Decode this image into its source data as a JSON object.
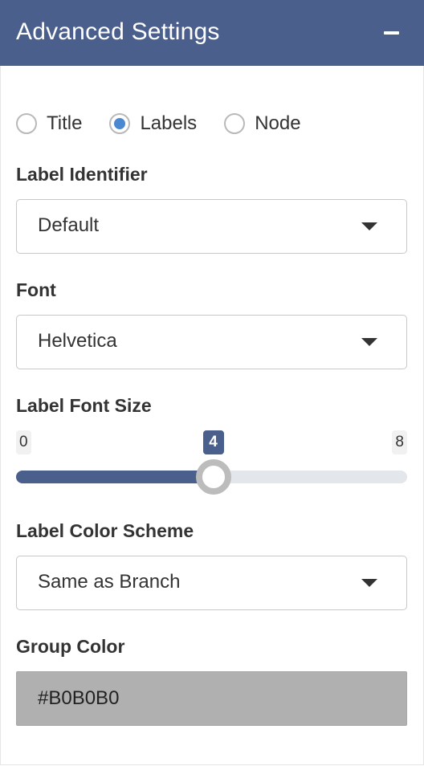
{
  "header": {
    "title": "Advanced Settings"
  },
  "label_mode": {
    "options": [
      {
        "label": "Title",
        "checked": false
      },
      {
        "label": "Labels",
        "checked": true
      },
      {
        "label": "Node",
        "checked": false
      }
    ]
  },
  "label_identifier": {
    "label": "Label Identifier",
    "value": "Default"
  },
  "font": {
    "label": "Font",
    "value": "Helvetica"
  },
  "label_font_size": {
    "label": "Label Font Size",
    "min": "0",
    "max": "8",
    "value": "4"
  },
  "label_color_scheme": {
    "label": "Label Color Scheme",
    "value": "Same as Branch"
  },
  "group_color": {
    "label": "Group Color",
    "value": "#B0B0B0"
  },
  "colors": {
    "header_bg": "#4a5f8c",
    "radio_accent": "#4a89d0",
    "group_color_swatch": "#b0b0b0"
  },
  "icons": {
    "collapse": "minus-icon",
    "select_arrow": "caret-down-icon"
  }
}
